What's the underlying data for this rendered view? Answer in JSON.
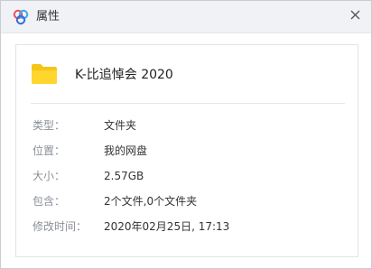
{
  "window": {
    "title": "属性",
    "app_icon": "baidu-netdisk-icon",
    "close_icon": "close-icon"
  },
  "file": {
    "name": "K-比追悼会 2020",
    "icon": "folder-icon",
    "folder_color": "#f5c518"
  },
  "properties": [
    {
      "label": "类型：",
      "value": "文件夹"
    },
    {
      "label": "位置：",
      "value": "我的网盘"
    },
    {
      "label": "大小：",
      "value": "2.57GB"
    },
    {
      "label": "包含：",
      "value": "2个文件,0个文件夹"
    },
    {
      "label": "修改时间：",
      "value": "2020年02月25日, 17:13"
    }
  ],
  "colors": {
    "titlebar_bg": "#f1f2f5",
    "label_text": "#8a8f99",
    "value_text": "#333333"
  }
}
